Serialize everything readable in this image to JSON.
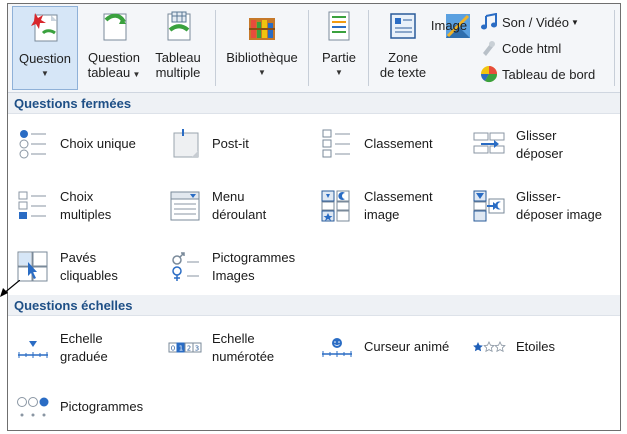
{
  "ribbon": {
    "question": {
      "label": "Question"
    },
    "question_tableau": {
      "line1": "Question",
      "line2": "tableau"
    },
    "tableau_multiple": {
      "line1": "Tableau",
      "line2": "multiple"
    },
    "bibliotheque": {
      "label": "Bibliothèque"
    },
    "partie": {
      "label": "Partie"
    },
    "zone_texte": {
      "line1": "Zone",
      "line2": "de texte"
    },
    "image": {
      "label": "Image"
    },
    "son_video": {
      "label": "Son / Vidéo"
    },
    "code_html": {
      "label": "Code html"
    },
    "tableau_bord": {
      "label": "Tableau de bord"
    }
  },
  "sections": {
    "fermees": {
      "title": "Questions fermées",
      "items": [
        {
          "line1": "Choix unique",
          "line2": ""
        },
        {
          "line1": "Post-it",
          "line2": ""
        },
        {
          "line1": "Classement",
          "line2": ""
        },
        {
          "line1": "Glisser",
          "line2": "déposer"
        },
        {
          "line1": "Choix",
          "line2": "multiples"
        },
        {
          "line1": "Menu",
          "line2": "déroulant"
        },
        {
          "line1": "Classement",
          "line2": "image"
        },
        {
          "line1": "Glisser-",
          "line2": "déposer image"
        },
        {
          "line1": "Pavés",
          "line2": "cliquables"
        },
        {
          "line1": "Pictogrammes",
          "line2": "Images"
        }
      ]
    },
    "echelles": {
      "title": "Questions échelles",
      "items": [
        {
          "line1": "Echelle",
          "line2": "graduée"
        },
        {
          "line1": "Echelle",
          "line2": "numérotée"
        },
        {
          "line1": "Curseur animé",
          "line2": ""
        },
        {
          "line1": "Etoiles",
          "line2": ""
        },
        {
          "line1": "Pictogrammes",
          "line2": ""
        }
      ]
    }
  },
  "colors": {
    "accent": "#1e4f86",
    "selected_bg": "#d6e6f7",
    "icon_blue": "#2a6cc4",
    "star": "#1f5fb8"
  }
}
